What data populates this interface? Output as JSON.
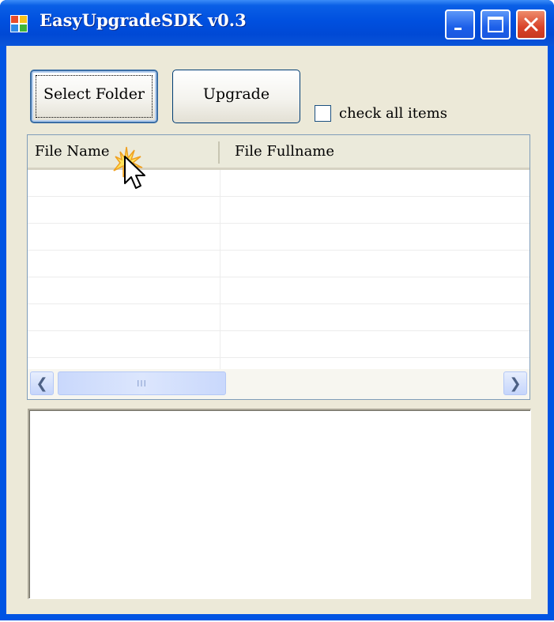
{
  "window": {
    "title": "EasyUpgradeSDK v0.3",
    "controls": [
      "minimize-icon",
      "maximize-icon",
      "close-icon"
    ]
  },
  "toolbar": {
    "select_folder_label": "Select Folder",
    "upgrade_label": "Upgrade",
    "check_all_label": "check all items",
    "check_all_checked": false
  },
  "file_list": {
    "columns": [
      "File Name",
      "File Fullname"
    ],
    "rows": [],
    "scrollbar_thumb_glyph": "III"
  },
  "output_box": {
    "text": ""
  },
  "colors": {
    "titlebar": "#0054e3",
    "client_bg": "#ece9d8",
    "close_button": "#d9432a"
  }
}
